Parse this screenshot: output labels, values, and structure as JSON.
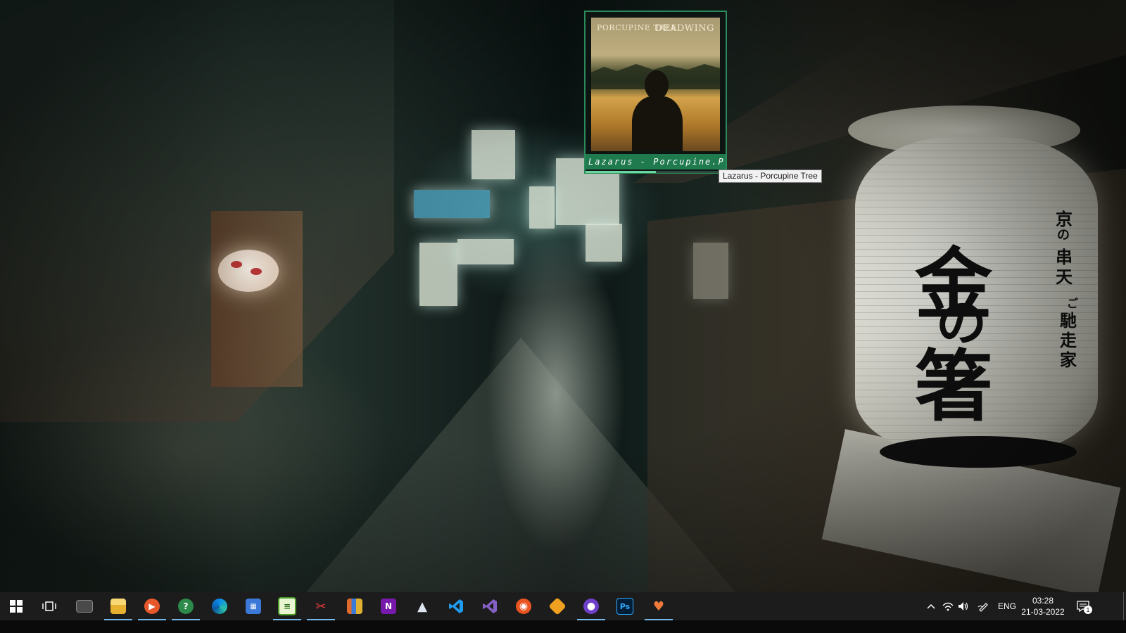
{
  "wallpaper": {
    "lantern_chars_main": [
      "金",
      "の",
      "箸"
    ],
    "lantern_chars_side": [
      "京",
      "の",
      "串",
      "天",
      "ご",
      "馳",
      "走",
      "家"
    ]
  },
  "media_widget": {
    "album_band_text": "PORCUPINE TREE",
    "album_title_text": "DEADWING",
    "track_label": "Lazarus - Porcupine.P",
    "progress_fraction": 0.5,
    "accent_color": "#1f7a4e",
    "tooltip": "Lazarus - Porcupine Tree"
  },
  "taskbar": {
    "start_icon": "windows-logo-icon",
    "apps": [
      {
        "name": "task-view-icon",
        "active": false
      },
      {
        "name": "desktop-app-icon",
        "active": false
      },
      {
        "name": "file-explorer-icon",
        "active": true
      },
      {
        "name": "media-player-icon",
        "active": true
      },
      {
        "name": "support-assist-icon",
        "active": true
      },
      {
        "name": "edge-browser-icon",
        "active": false
      },
      {
        "name": "calculator-icon",
        "active": false
      },
      {
        "name": "sheets-app-icon",
        "active": true
      },
      {
        "name": "snipping-tool-icon",
        "active": true
      },
      {
        "name": "library-books-icon",
        "active": false
      },
      {
        "name": "onenote-icon",
        "active": false
      },
      {
        "name": "inkscape-icon",
        "active": false
      },
      {
        "name": "vscode-icon",
        "active": false
      },
      {
        "name": "visual-studio-icon",
        "active": false
      },
      {
        "name": "ubuntu-icon",
        "active": false
      },
      {
        "name": "money-manager-icon",
        "active": false
      },
      {
        "name": "github-desktop-icon",
        "active": true
      },
      {
        "name": "photoshop-icon",
        "active": false
      },
      {
        "name": "heart-app-icon",
        "active": true
      }
    ],
    "onenote_letter": "N",
    "photoshop_letters": "Ps",
    "tray": {
      "language": "ENG",
      "time": "03:28",
      "date": "21-03-2022",
      "notification_count": "1"
    }
  }
}
